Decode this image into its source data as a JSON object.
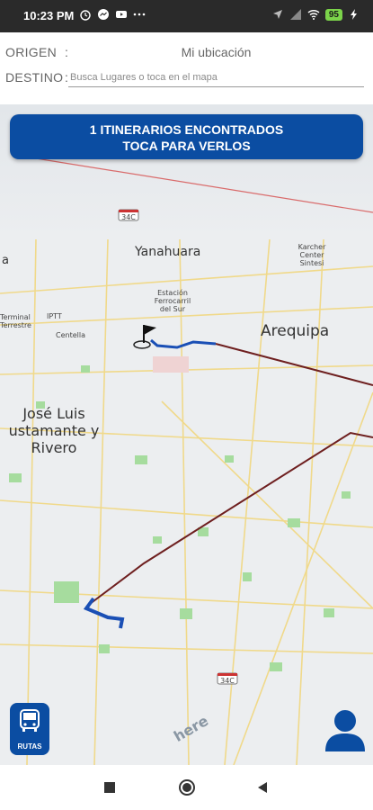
{
  "status_bar": {
    "time": "10:23 PM",
    "battery": "95"
  },
  "form": {
    "origin_label": "ORIGEN",
    "origin_value": "Mi ubicación",
    "destination_label": "DESTINO",
    "destination_placeholder": "Busca Lugares o toca en el mapa",
    "colon": ":"
  },
  "banner": {
    "line1": "1 ITINERARIOS ENCONTRADOS",
    "line2": "TOCA PARA VERLOS"
  },
  "map": {
    "labels": {
      "yanahuara": "Yanahuara",
      "arequipa": "Arequipa",
      "jose_luis_1": "José Luis",
      "jose_luis_2": "ustamante y",
      "jose_luis_3": "Rivero",
      "karcher_1": "Karcher",
      "karcher_2": "Center",
      "karcher_3": "Sintesi",
      "estacion_1": "Estación",
      "estacion_2": "Ferrocarril",
      "estacion_3": "del Sur",
      "terminal_1": "Terminal",
      "terminal_2": "Terrestre",
      "iptt": "IPTT",
      "centella": "Centella",
      "left_a": "a",
      "road_34c_top": "34C",
      "road_34c_bottom": "34C",
      "here": "here"
    },
    "route_color": "#6e1f1f",
    "walk_color": "#1a4fb5"
  },
  "buttons": {
    "routes_label": "RUTAS"
  }
}
